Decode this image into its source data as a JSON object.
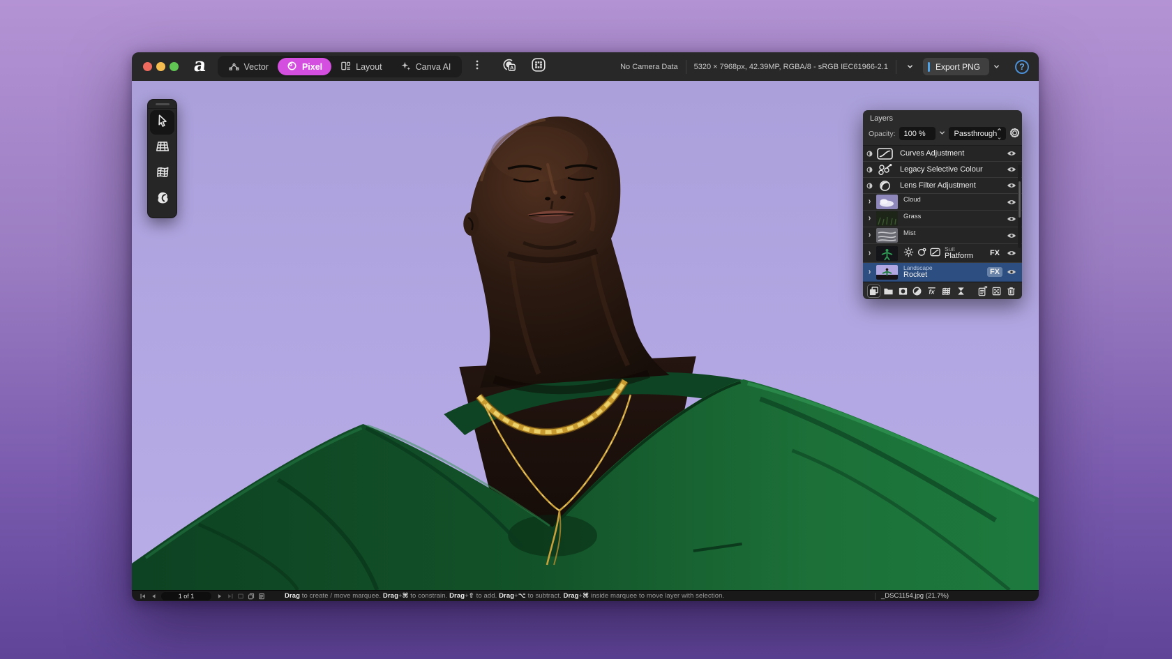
{
  "colors": {
    "accent_magenta": "#d44fe0",
    "accent_blue": "#4da3e8",
    "selected_layer_blue": "#2d4e80",
    "canvas_sky": "#b2a6e2",
    "suit_green": "#16602f",
    "gold": "#c89b30",
    "desktop_top": "#b493d4",
    "desktop_bottom": "#5f4498"
  },
  "titlebar": {
    "logo": "a",
    "tabs": [
      {
        "id": "vector",
        "label": "Vector",
        "icon": "vector",
        "active": false
      },
      {
        "id": "pixel",
        "label": "Pixel",
        "icon": "pixel",
        "active": true
      },
      {
        "id": "layout",
        "label": "Layout",
        "icon": "layout",
        "active": false
      },
      {
        "id": "canva-ai",
        "label": "Canva AI",
        "icon": "sparkle",
        "active": false
      }
    ],
    "camera_status": "No Camera Data",
    "document_info": "5320 × 7968px, 42.39MP, RGBA/8 - sRGB IEC61966-2.1",
    "export_label": "Export PNG",
    "help_label": "?"
  },
  "tool_palette": [
    {
      "id": "move-tool",
      "icon": "cursor",
      "selected": true
    },
    {
      "id": "perspective-tool",
      "icon": "gridflat",
      "selected": false
    },
    {
      "id": "mesh-warp-tool",
      "icon": "gridwarp",
      "selected": false
    },
    {
      "id": "liquify-tool",
      "icon": "liquify",
      "selected": false
    }
  ],
  "layers_panel": {
    "title": "Layers",
    "opacity_label": "Opacity:",
    "opacity_value": "100 %",
    "blend_mode": "Passthrough",
    "rows": [
      {
        "kind": "adjustment",
        "icon": "curves",
        "name": "Curves Adjustment"
      },
      {
        "kind": "adjustment",
        "icon": "selective",
        "name": "Legacy Selective Colour"
      },
      {
        "kind": "adjustment",
        "icon": "lens",
        "name": "Lens Filter Adjustment"
      },
      {
        "kind": "group",
        "name": "Cloud",
        "thumb": "cloud"
      },
      {
        "kind": "group",
        "name": "Grass",
        "thumb": "grass"
      },
      {
        "kind": "group",
        "name": "Mist",
        "thumb": "mist"
      },
      {
        "kind": "fxgroup",
        "label": "Suit",
        "name": "Platform",
        "thumb": "figure",
        "minis": [
          "sun",
          "circledot",
          "curvesmini"
        ],
        "fx": "FX",
        "selected": false
      },
      {
        "kind": "fxgroup",
        "label": "Landscape",
        "name": "Rocket",
        "thumb": "landscape",
        "minis": [],
        "fx": "FX",
        "selected": true
      }
    ],
    "footer_icons": [
      "new-layer",
      "new-group",
      "mask-layer",
      "adjustment-layer",
      "live-filter",
      "mesh",
      "hourglass",
      "merge",
      "pixel-grid",
      "delete"
    ]
  },
  "statusbar": {
    "nav_icons_left": [
      "first-page",
      "previous-page"
    ],
    "page_indicator": "1 of 1",
    "nav_icons_right": [
      "next-page",
      "last-page",
      "frame",
      "duplicate",
      "notes"
    ],
    "hint_segments": [
      {
        "text": "Drag",
        "bold": true
      },
      {
        "text": " to create / move marquee. "
      },
      {
        "text": "Drag",
        "bold": true
      },
      {
        "text": "+"
      },
      {
        "text": "⌘",
        "bold": true
      },
      {
        "text": " to constrain. "
      },
      {
        "text": "Drag",
        "bold": true
      },
      {
        "text": "+"
      },
      {
        "text": "⇧",
        "bold": true
      },
      {
        "text": " to add. "
      },
      {
        "text": "Drag",
        "bold": true
      },
      {
        "text": "+"
      },
      {
        "text": "⌥",
        "bold": true
      },
      {
        "text": " to subtract. "
      },
      {
        "text": "Drag",
        "bold": true
      },
      {
        "text": "+"
      },
      {
        "text": "⌘",
        "bold": true
      },
      {
        "text": " inside marquee to move layer with selection."
      }
    ],
    "document_name": "_DSC1154.jpg (21.7%)"
  }
}
